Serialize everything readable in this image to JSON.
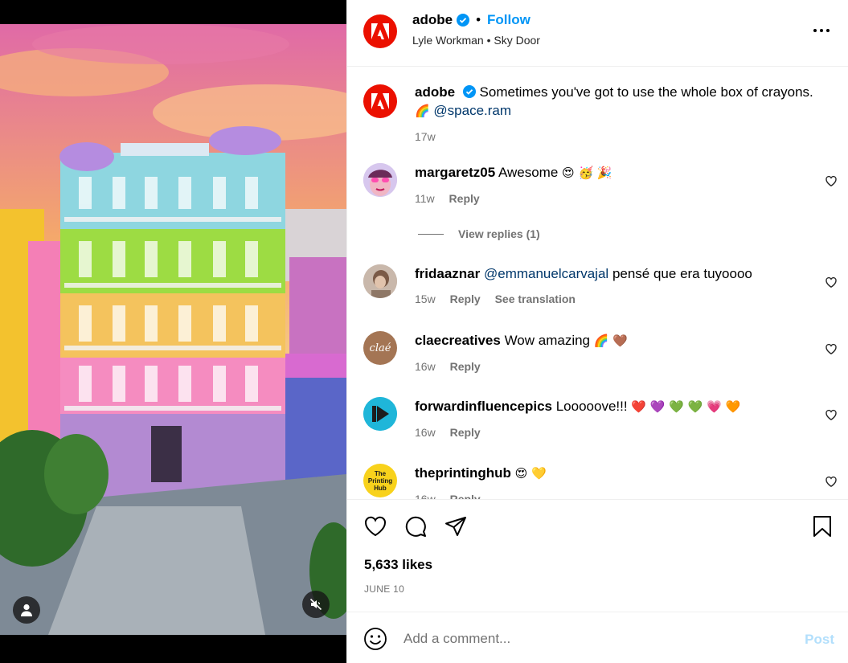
{
  "post": {
    "author": "adobe",
    "follow_label": "Follow",
    "separator": "•",
    "audio": "Lyle Workman • Sky Door",
    "more_icon": "more-horizontal-icon"
  },
  "caption": {
    "username": "adobe",
    "text": "Sometimes you've got to use the whole box of crayons.",
    "emoji": "🌈",
    "mention": "@space.ram",
    "age": "17w"
  },
  "comments": [
    {
      "username": "margaretz05",
      "text": "Awesome",
      "emoji": "😍 🥳 🎉",
      "age": "11w",
      "reply": "Reply",
      "avatar_color": "#c9b7e5"
    },
    {
      "username": "fridaaznar",
      "mention": "@emmanuelcarvajal",
      "text": "pensé que era tuyoooo",
      "age": "15w",
      "reply": "Reply",
      "translate": "See translation",
      "avatar_color": "#b8a496"
    },
    {
      "username": "claecreatives",
      "text": "Wow amazing",
      "emoji": "🌈 🤎",
      "age": "16w",
      "reply": "Reply",
      "avatar_text": "claé",
      "avatar_color": "#a47554"
    },
    {
      "username": "forwardinfluencepics",
      "text": "Looooove!!!",
      "emoji": "❤️ 💜 💚 💚 💗 🧡",
      "age": "16w",
      "reply": "Reply",
      "avatar_color": "#1fb6d9"
    },
    {
      "username": "theprintinghub",
      "text": "",
      "emoji": "😍 💛",
      "age": "16w",
      "reply": "Reply",
      "avatar_text": "The Printing Hub",
      "avatar_color": "#f8d21c"
    }
  ],
  "view_replies": "View replies (1)",
  "actions": {
    "likes": "5,633 likes",
    "date": "JUNE 10"
  },
  "composer": {
    "placeholder": "Add a comment...",
    "post_label": "Post"
  },
  "colors": {
    "brand_red": "#eb1000",
    "link_blue": "#0095f6",
    "muted": "#737373",
    "verified_blue": "#0095f6"
  }
}
